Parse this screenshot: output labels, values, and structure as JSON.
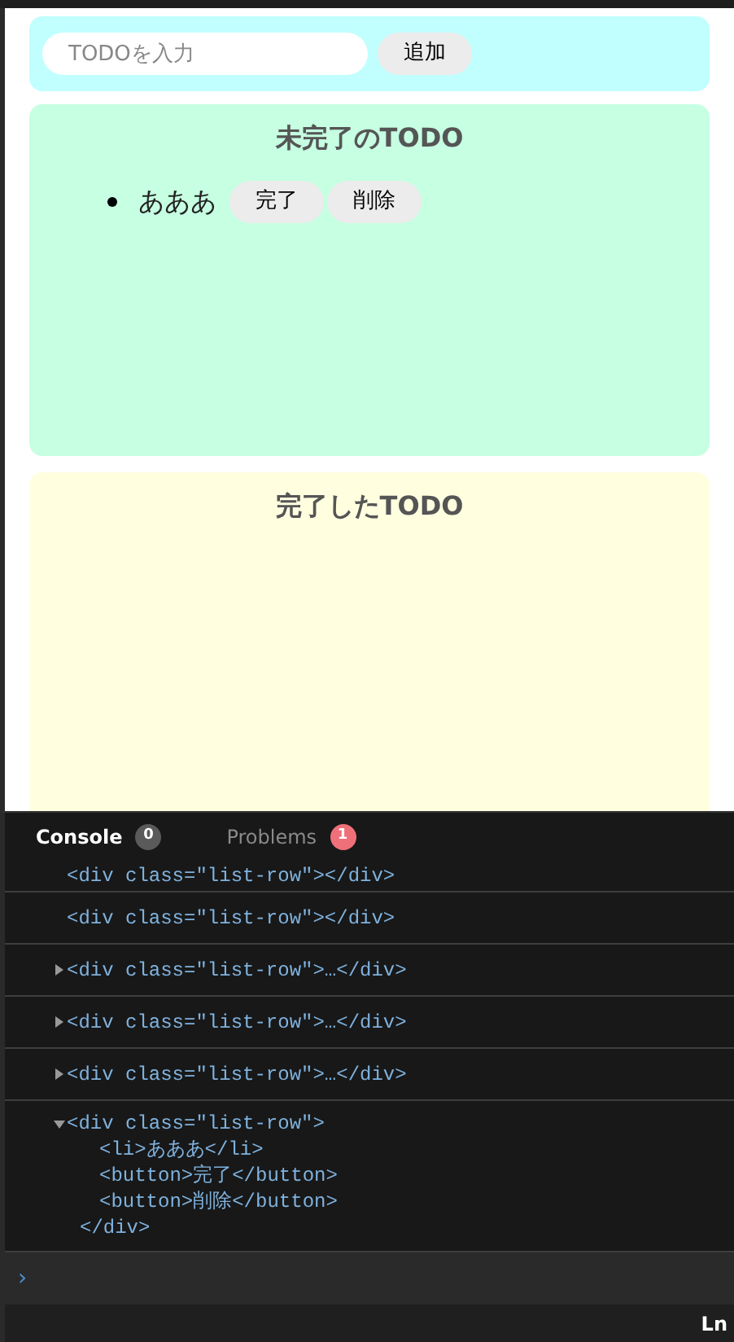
{
  "add_form": {
    "placeholder": "TODOを入力",
    "button": "追加"
  },
  "incomplete": {
    "title": "未完了のTODO",
    "items": [
      {
        "text": "あああ",
        "buttons": [
          "完了",
          "削除"
        ]
      }
    ]
  },
  "complete": {
    "title": "完了したTODO"
  },
  "devtools": {
    "tabs": [
      {
        "label": "Console",
        "count": "0",
        "selected": true,
        "color": "#5a5a5a"
      },
      {
        "label": "Problems",
        "count": "1",
        "selected": false,
        "color": "#f0707a"
      }
    ],
    "entries": [
      {
        "kind": "plain",
        "lines": [
          "<div class=\"list-row\"></div>"
        ]
      },
      {
        "kind": "plain",
        "lines": [
          "<div class=\"list-row\"></div>"
        ]
      },
      {
        "kind": "collapsed",
        "lines": [
          "<div class=\"list-row\">…</div>"
        ]
      },
      {
        "kind": "collapsed",
        "lines": [
          "<div class=\"list-row\">…</div>"
        ]
      },
      {
        "kind": "collapsed",
        "lines": [
          "<div class=\"list-row\">…</div>"
        ]
      },
      {
        "kind": "expanded",
        "lines": [
          "<div class=\"list-row\">",
          "<li>あああ</li>",
          "<button>完了</button>",
          "<button>削除</button>",
          "</div>"
        ]
      }
    ],
    "prompt": "›",
    "status": "Ln"
  }
}
